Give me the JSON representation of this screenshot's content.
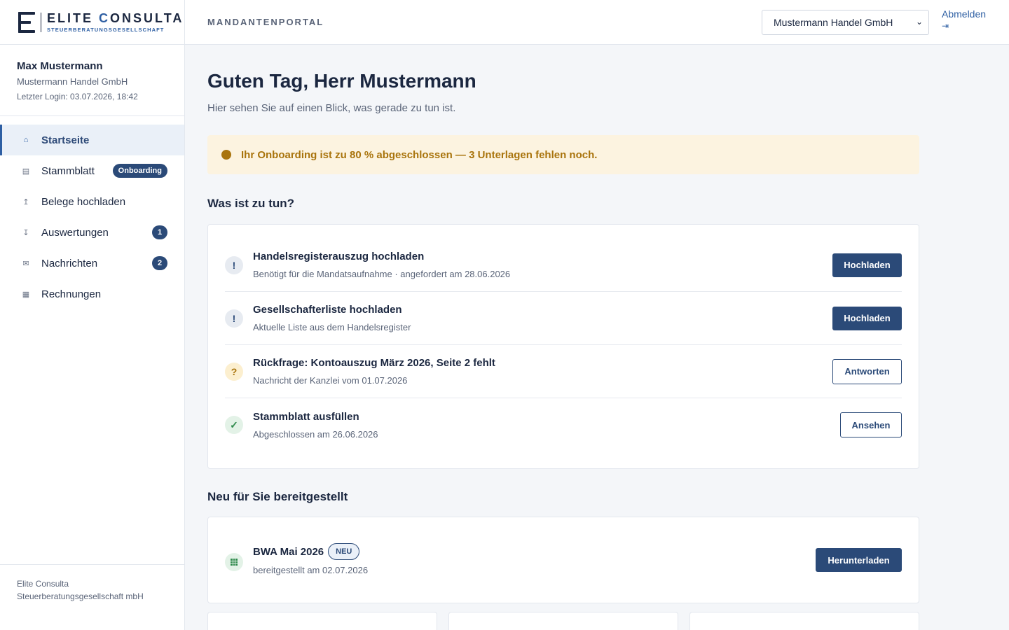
{
  "logo": {
    "name_part1": "ELITE",
    "name_part2": "C",
    "name_part3": "ONSULTA",
    "tagline": "STEUERBERATUNGSGESELLSCHAFT"
  },
  "user": {
    "name": "Max Mustermann",
    "company": "Mustermann Handel GmbH",
    "last_login": "Letzter Login: 03.07.2026, 18:42"
  },
  "nav": [
    {
      "label": "Startseite",
      "icon": "home-icon",
      "active": true
    },
    {
      "label": "Stammblatt",
      "icon": "document-icon",
      "badge": "Onboarding"
    },
    {
      "label": "Belege hochladen",
      "icon": "upload-icon"
    },
    {
      "label": "Auswertungen",
      "icon": "download-icon",
      "badge": "1"
    },
    {
      "label": "Nachrichten",
      "icon": "mail-icon",
      "badge": "2"
    },
    {
      "label": "Rechnungen",
      "icon": "invoice-grid-icon"
    }
  ],
  "footer": {
    "line1": "Elite Consulta",
    "line2": "Steuerberatungsgesellschaft mbH"
  },
  "header": {
    "portal_title": "MANDANTENPORTAL",
    "client_select": "Mustermann Handel GmbH",
    "logout": "Abmelden"
  },
  "main": {
    "greeting": "Guten Tag, Herr Mustermann",
    "subtitle": "Hier sehen Sie auf einen Blick, was gerade zu tun ist.",
    "alert": "Ihr Onboarding ist zu 80 % abgeschlossen — 3 Unterlagen fehlen noch.",
    "todo_title": "Was ist zu tun?",
    "tasks": [
      {
        "title": "Handelsregisterauszug hochladen",
        "subtitle": "Benötigt für die Mandatsaufnahme · angefordert am 28.06.2026",
        "icon": "!",
        "button": "Hochladen"
      },
      {
        "title": "Gesellschafterliste hochladen",
        "subtitle": "Aktuelle Liste aus dem Handelsregister",
        "icon": "!",
        "button": "Hochladen"
      },
      {
        "title": "Rückfrage: Kontoauszug März 2026, Seite 2 fehlt",
        "subtitle": "Nachricht der Kanzlei vom 01.07.2026",
        "icon": "?",
        "button": "Antworten"
      },
      {
        "title": "Stammblatt ausfüllen",
        "subtitle": "Abgeschlossen am 26.06.2026",
        "icon": "✓",
        "button": "Ansehen"
      }
    ],
    "new_title": "Neu für Sie bereitgestellt",
    "new_doc": {
      "title": "BWA Mai 2026",
      "badge": "NEU",
      "subtitle": "bereitgestellt am 02.07.2026",
      "button": "Herunterladen"
    }
  },
  "colors": {
    "primary": "#2b4a78",
    "accent": "#2e5fa3",
    "warning": "#a9740d",
    "success": "#2f8a4c"
  }
}
